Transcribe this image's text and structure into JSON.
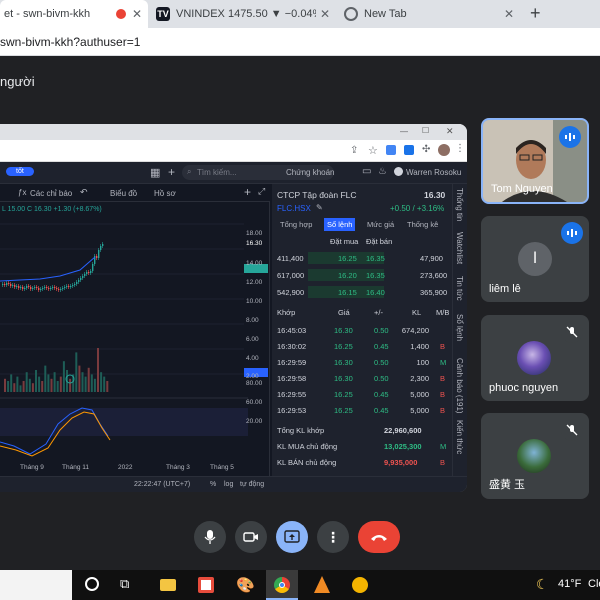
{
  "tabs": [
    {
      "title": "et - swn-bivm-kkh",
      "active": true
    },
    {
      "title": "VNINDEX 1475.50 ▼ −0.04% Vô",
      "icon": "TV"
    },
    {
      "title": "New Tab"
    }
  ],
  "new_tab_symbol": "+",
  "address": {
    "url": "swn-bivm-kkh?authuser=1"
  },
  "meet": {
    "title": "người"
  },
  "tradingview": {
    "badge": "tốt",
    "search_placeholder": "Tìm kiếm...",
    "market_select": "Chứng khoán",
    "user": "Warren Rosoku",
    "toolbar": {
      "indicators": "Các chỉ báo",
      "chart_type": "Biểu đồ",
      "profile": "Hồ sơ"
    },
    "ohlc_line": "L 15.00  C 16.30 +1.30 (+8.67%)",
    "price_scale": [
      "18.00",
      "16.30",
      "14.00",
      "12.00",
      "10.00",
      "8.00",
      "6.00",
      "4.00",
      "2.00",
      "80.00",
      "60.00",
      "20.00"
    ],
    "time_labels": [
      "Tháng 9",
      "Tháng 11",
      "2022",
      "Tháng 3",
      "Tháng 5"
    ],
    "time_display": "22:22:47 (UTC+7)",
    "bottom_opts": [
      "%",
      "log",
      "tự động"
    ],
    "symbol_info": {
      "name": "CTCP Tập đoàn FLC",
      "price": "16.30",
      "ticker": "FLC.HSX",
      "change": "+0.50 / +3.16%"
    },
    "panel_tabs": [
      "Tổng hợp",
      "Sổ lệnh",
      "Mức giá",
      "Thống kê"
    ],
    "active_panel_tab": "Sổ lệnh",
    "orderbook_headers": {
      "bid": "Đặt mua",
      "ask": "Đặt bán"
    },
    "orderbook": [
      {
        "bid_vol": "411,400",
        "bid_price": "16.25",
        "ask_price": "16.35",
        "ask_vol": "47,900"
      },
      {
        "bid_vol": "617,000",
        "bid_price": "16.20",
        "ask_price": "16.35",
        "ask_vol": "273,600"
      },
      {
        "bid_vol": "542,900",
        "bid_price": "16.15",
        "ask_price": "16.40",
        "ask_vol": "365,900"
      }
    ],
    "trade_headers": [
      "Khớp",
      "Giá",
      "+/-",
      "KL",
      "M/B"
    ],
    "trades": [
      {
        "time": "16:45:03",
        "price": "16.30",
        "chg": "0.50",
        "vol": "674,200",
        "side": ""
      },
      {
        "time": "16:30:02",
        "price": "16.25",
        "chg": "0.45",
        "vol": "1,400",
        "side": "B"
      },
      {
        "time": "16:29:59",
        "price": "16.30",
        "chg": "0.50",
        "vol": "100",
        "side": "M"
      },
      {
        "time": "16:29:58",
        "price": "16.30",
        "chg": "0.50",
        "vol": "2,300",
        "side": "B"
      },
      {
        "time": "16:29:55",
        "price": "16.25",
        "chg": "0.45",
        "vol": "5,000",
        "side": "B"
      },
      {
        "time": "16:29:53",
        "price": "16.25",
        "chg": "0.45",
        "vol": "5,000",
        "side": "B"
      }
    ],
    "totals": [
      {
        "label": "Tổng KL khớp",
        "value": "22,960,600",
        "tag": ""
      },
      {
        "label": "KL MUA chủ động",
        "value": "13,025,300",
        "tag": "M"
      },
      {
        "label": "KL BÁN chủ động",
        "value": "9,935,000",
        "tag": "B"
      }
    ],
    "side_tabs": [
      "Thống tin",
      "Watchlist",
      "Tin tức",
      "Sổ lệnh",
      "Cảnh báo (191)",
      "Kiến thức"
    ]
  },
  "participants": [
    {
      "name": "Tom Nguyen",
      "speaking": true
    },
    {
      "name": "liêm lê",
      "initial": "l",
      "speaking": true
    },
    {
      "name": "phuoc nguyen",
      "muted": true
    },
    {
      "name": "盛黄 玉",
      "muted": true
    }
  ],
  "taskbar": {
    "weather_temp": "41°F",
    "weather_text": "Cle"
  },
  "colors": {
    "accent": "#8ab4f8",
    "end_call": "#ea4335",
    "up": "#26a69a",
    "down": "#ef5350",
    "badge": "#1a73e8"
  }
}
